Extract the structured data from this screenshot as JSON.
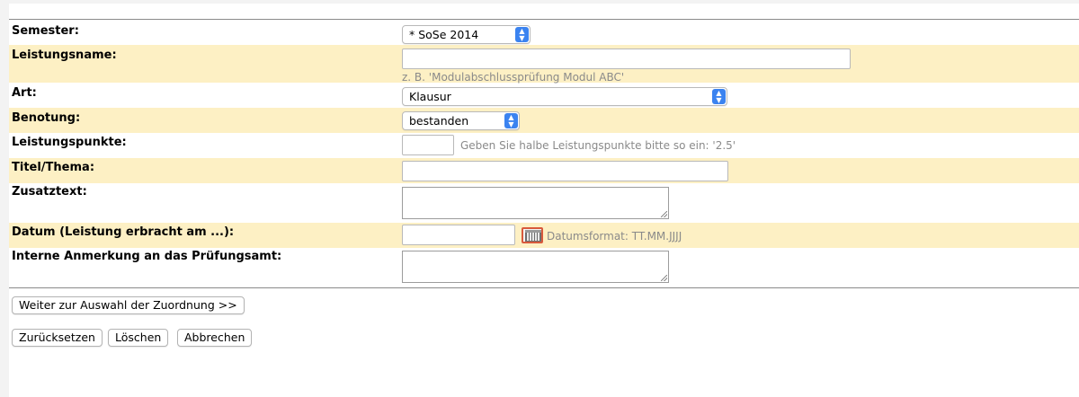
{
  "form": {
    "semester": {
      "label": "Semester:",
      "value": "* SoSe 2014"
    },
    "leistungsname": {
      "label": "Leistungsname:",
      "value": "",
      "hint": "z. B. 'Modulabschlussprüfung Modul ABC'"
    },
    "art": {
      "label": "Art:",
      "value": "Klausur"
    },
    "benotung": {
      "label": "Benotung:",
      "value": "bestanden"
    },
    "leistungspunkte": {
      "label": "Leistungspunkte:",
      "value": "",
      "hint": "Geben Sie halbe Leistungspunkte bitte so ein: '2.5'"
    },
    "titel": {
      "label": "Titel/Thema:",
      "value": ""
    },
    "zusatztext": {
      "label": "Zusatztext:",
      "value": ""
    },
    "datum": {
      "label": "Datum (Leistung erbracht am ...):",
      "value": "",
      "hint": "Datumsformat: TT.MM.JJJJ",
      "calendar_icon": "calendar-icon"
    },
    "anmerkung": {
      "label": "Interne Anmerkung an das Prüfungsamt:",
      "value": ""
    }
  },
  "buttons": {
    "next": "Weiter zur Auswahl der Zuordnung >>",
    "reset": "Zurücksetzen",
    "delete": "Löschen",
    "cancel": "Abbrechen"
  },
  "colors": {
    "row_highlight": "#fdf0c4",
    "select_accent": "#3b83f0",
    "calendar_border": "#d85a3c"
  }
}
